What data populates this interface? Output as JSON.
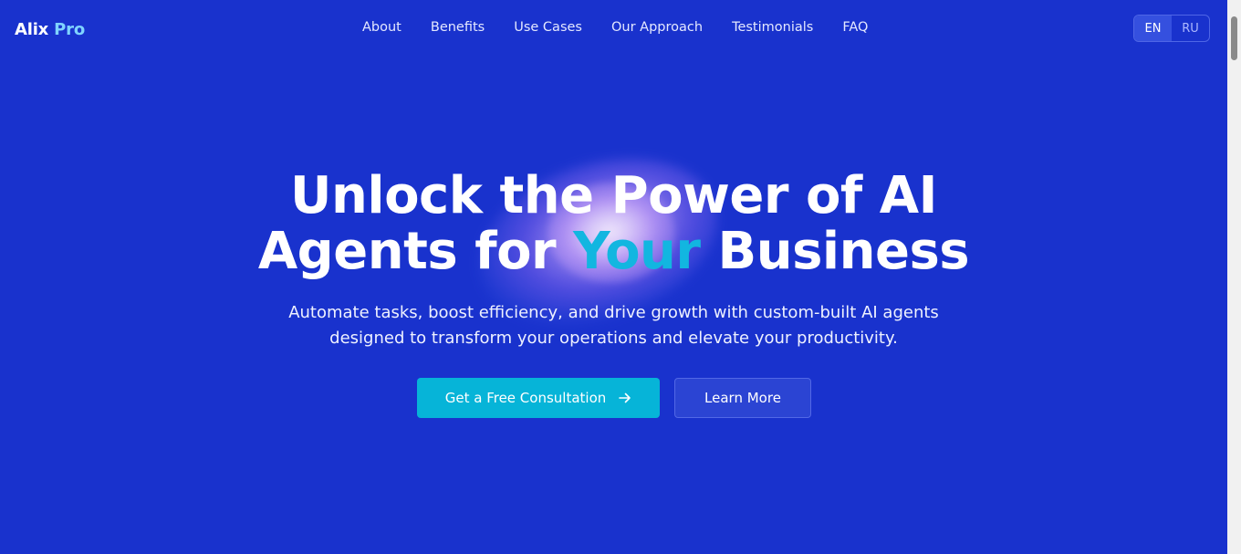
{
  "header": {
    "logo_main": "Alix",
    "logo_accent": "Pro",
    "nav": [
      {
        "label": "About"
      },
      {
        "label": "Benefits"
      },
      {
        "label": "Use Cases"
      },
      {
        "label": "Our Approach"
      },
      {
        "label": "Testimonials"
      },
      {
        "label": "FAQ"
      }
    ],
    "languages": [
      {
        "label": "EN",
        "active": true
      },
      {
        "label": "RU",
        "active": false
      }
    ]
  },
  "hero": {
    "title_line1": "Unlock the Power of AI",
    "title_line2_before": "Agents for",
    "title_highlight": "Your",
    "title_line2_after": "Business",
    "subtitle_line1": "Automate tasks, boost efficiency, and drive growth with custom-built AI agents",
    "subtitle_line2": "designed to transform your operations and elevate your productivity.",
    "primary_button": "Get a Free Consultation",
    "primary_button_icon": "arrow-right-icon",
    "secondary_button": "Learn More"
  },
  "colors": {
    "background": "#1932cd",
    "accent": "#06b4d8",
    "highlight_text": "#12b6e0",
    "logo_accent": "#7fd3ff"
  }
}
